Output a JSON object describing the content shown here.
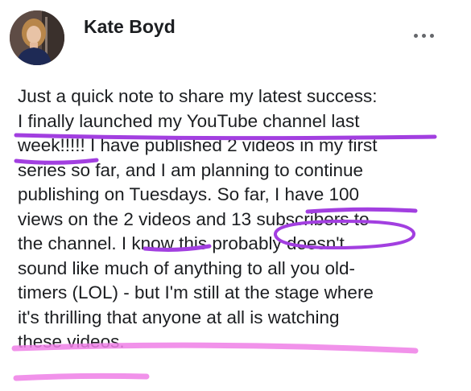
{
  "post": {
    "author": "Kate Boyd",
    "menu_icon": "more-horizontal-icon",
    "lines": [
      "Just a quick note to share my latest success:",
      "I finally launched my YouTube channel last",
      "week!!!!! I have published 2 videos in my first",
      "series so far, and I am planning to continue",
      "publishing on Tuesdays. So far, I have 100",
      "views on the 2 videos and 13 subscribers to",
      "the channel. I know this probably doesn't",
      "sound like much of anything to all you old-",
      "timers (LOL) - but I'm still at the stage where",
      "it's thrilling that anyone at all is watching",
      "these videos."
    ]
  },
  "annotations": {
    "purple": "#a23fe0",
    "pink": "#ee7fe6"
  }
}
